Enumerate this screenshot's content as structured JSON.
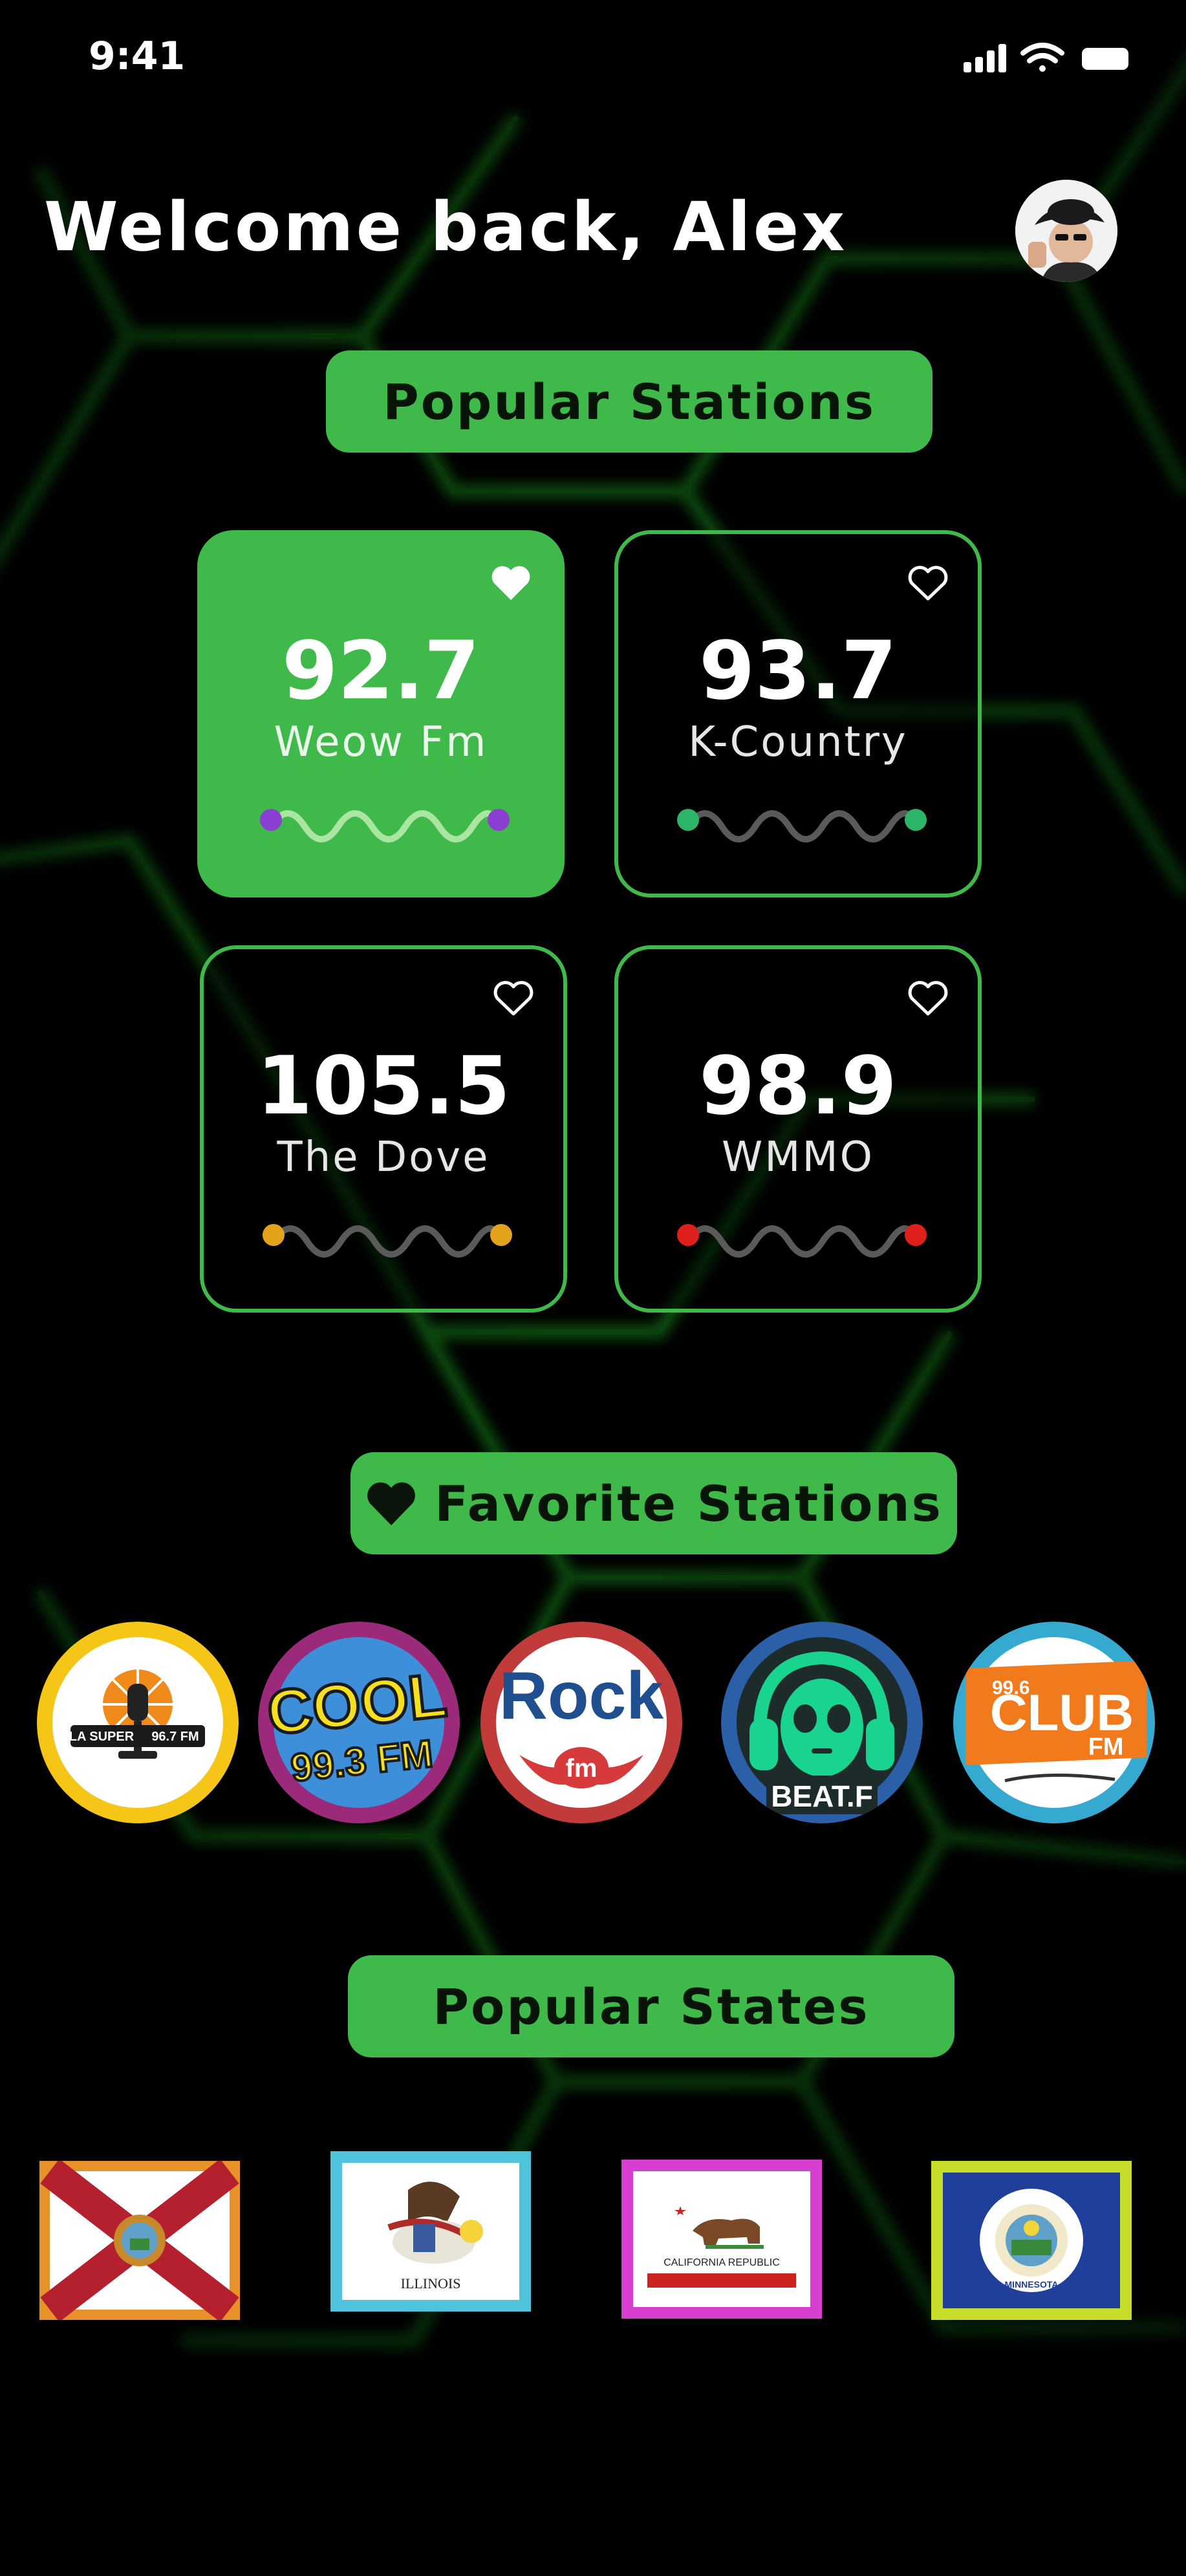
{
  "status_bar": {
    "time": "9:41"
  },
  "header": {
    "greeting": "Welcome back, Alex",
    "avatar_icon": "user-avatar"
  },
  "popular_stations": {
    "title": "Popular Stations",
    "stations": [
      {
        "frequency": "92.7",
        "name": "Weow Fm",
        "favorited": true,
        "active": true,
        "dot_color": "#8a3fd1"
      },
      {
        "frequency": "93.7",
        "name": "K-Country",
        "favorited": false,
        "active": false,
        "dot_color": "#2db56a"
      },
      {
        "frequency": "105.5",
        "name": "The Dove",
        "favorited": false,
        "active": false,
        "dot_color": "#e3a21b"
      },
      {
        "frequency": "98.9",
        "name": "WMMO",
        "favorited": false,
        "active": false,
        "dot_color": "#e0201c"
      }
    ]
  },
  "favorite_stations": {
    "title": "Favorite Stations",
    "logos": [
      {
        "icon": "la-super-967-fm-logo",
        "ring_color": "#f5c518",
        "text": "LA SUPER",
        "freq": "96.7 FM"
      },
      {
        "icon": "cool-933-fm-logo",
        "ring_color": "#9b2a7a",
        "text": "COOL",
        "freq": "99.3 FM"
      },
      {
        "icon": "rock-fm-logo",
        "ring_color": "#c23b3b",
        "text": "Rock",
        "freq": "fm"
      },
      {
        "icon": "beat-fm-logo",
        "ring_color": "#2b5fa8",
        "text": "BEAT.F",
        "freq": ""
      },
      {
        "icon": "club-fm-996-logo",
        "ring_color": "#35a9cf",
        "text": "CLUB",
        "freq": "99.6",
        "sub": "FM"
      }
    ]
  },
  "popular_states": {
    "title": "Popular States",
    "flags": [
      {
        "icon": "florida-flag",
        "border_color": "#e8922a"
      },
      {
        "icon": "illinois-flag",
        "border_color": "#4fc3dc",
        "label": "ILLINOIS"
      },
      {
        "icon": "california-flag",
        "border_color": "#d83fd1",
        "label": "CALIFORNIA REPUBLIC"
      },
      {
        "icon": "minnesota-flag",
        "border_color": "#c8dc2a",
        "label": "MINNESOTA"
      }
    ]
  },
  "colors": {
    "accent": "#3fba4a",
    "background": "#000000"
  }
}
